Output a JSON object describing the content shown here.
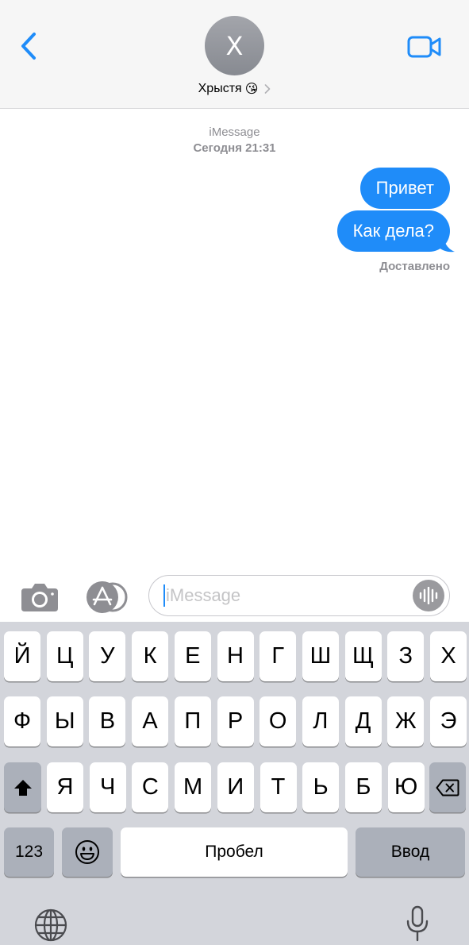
{
  "header": {
    "back_icon": "chevron-left-icon",
    "avatar_initial": "Х",
    "contact_name": "Хрыстя",
    "contact_emoji": "😘",
    "chevron_icon": "chevron-right-icon",
    "video_icon": "video-camera-icon",
    "accent_color": "#1f8cf9"
  },
  "thread": {
    "service": "iMessage",
    "timestamp": "Сегодня 21:31",
    "messages": [
      {
        "text": "Привет",
        "direction": "outgoing"
      },
      {
        "text": "Как дела?",
        "direction": "outgoing"
      }
    ],
    "status": "Доставлено",
    "bubble_color": "#1f8cf9"
  },
  "composer": {
    "camera_icon": "camera-icon",
    "apps_icon": "app-store-icon",
    "placeholder": "iMessage",
    "value": "",
    "voice_icon": "waveform-icon"
  },
  "keyboard": {
    "row1": [
      "Й",
      "Ц",
      "У",
      "К",
      "Е",
      "Н",
      "Г",
      "Ш",
      "Щ",
      "З",
      "Х"
    ],
    "row2": [
      "Ф",
      "Ы",
      "В",
      "А",
      "П",
      "Р",
      "О",
      "Л",
      "Д",
      "Ж",
      "Э"
    ],
    "row3": [
      "Я",
      "Ч",
      "С",
      "М",
      "И",
      "Т",
      "Ь",
      "Б",
      "Ю"
    ],
    "shift_icon": "shift-arrow-icon",
    "delete_icon": "backspace-icon",
    "numbers_label": "123",
    "emoji_icon": "emoji-icon",
    "space_label": "Пробел",
    "return_label": "Ввод",
    "globe_icon": "globe-icon",
    "mic_icon": "microphone-icon"
  }
}
